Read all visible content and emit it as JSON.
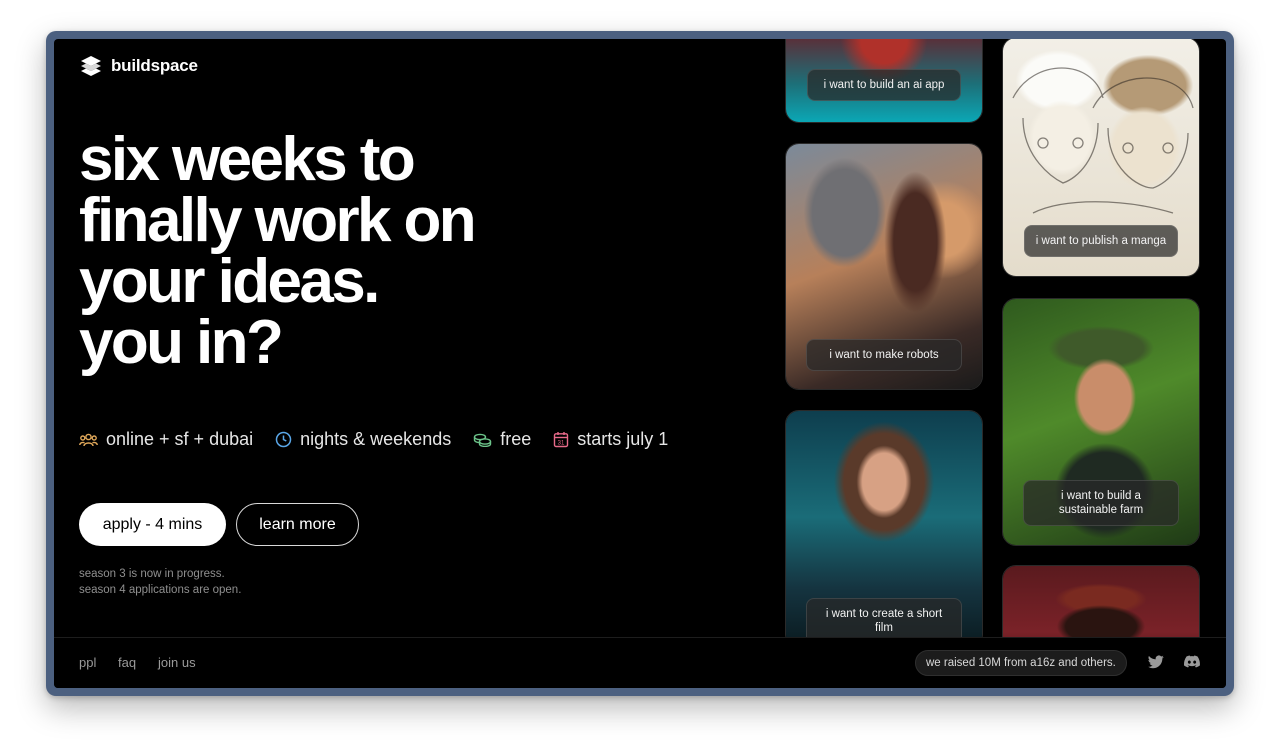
{
  "brand": {
    "name": "buildspace"
  },
  "hero": {
    "lines": [
      "six weeks to",
      "finally work on",
      "your ideas.",
      "you in?"
    ]
  },
  "info": {
    "location": "online + sf + dubai",
    "time": "nights & weekends",
    "price": "free",
    "start": "starts july 1"
  },
  "actions": {
    "apply_label": "apply - 4 mins",
    "learn_label": "learn more"
  },
  "status": {
    "line1": "season 3 is now in progress.",
    "line2": "season 4 applications are open."
  },
  "footer": {
    "links": [
      "ppl",
      "faq",
      "join us"
    ],
    "raised": "we raised 10M from a16z and others."
  },
  "cards": [
    {
      "label": "i want to build an ai app"
    },
    {
      "label": "i want to make robots"
    },
    {
      "label": "i want to create a short film"
    },
    {
      "label": "i want to publish a manga"
    },
    {
      "label": "i want to build a sustainable farm"
    },
    {
      "label": ""
    }
  ],
  "icons": {
    "people": "people-icon",
    "clock": "clock-icon",
    "coins": "coins-icon",
    "calendar": "calendar-icon",
    "twitter": "twitter-icon",
    "discord": "discord-icon"
  },
  "colors": {
    "background": "#000000",
    "people_icon": "#e0a85a",
    "clock_icon": "#5aa7e8",
    "coins_icon": "#6cc48a",
    "calendar_icon": "#e86a8a"
  }
}
